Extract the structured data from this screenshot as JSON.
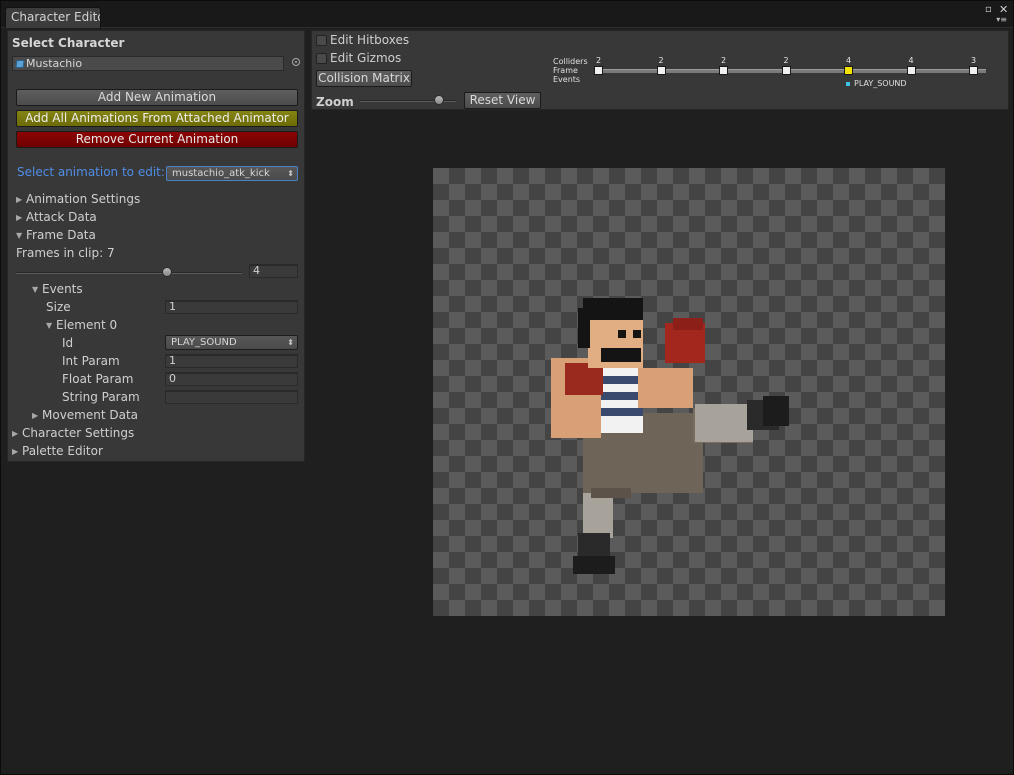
{
  "window": {
    "tab_title": "Character Edito",
    "icons": {
      "maximize": "maximize-icon",
      "close": "close-icon",
      "menu": "panel-menu-icon"
    }
  },
  "inspector": {
    "header": "Select Character",
    "character_field": "Mustachio",
    "buttons": {
      "add_new": "Add New Animation",
      "add_all": "Add All Animations From Attached Animator",
      "remove": "Remove Current Animation"
    },
    "select_label": "Select animation to edit:",
    "selected_animation": "mustachio_atk_kick",
    "sections": {
      "animation_settings": "Animation Settings",
      "attack_data": "Attack Data",
      "frame_data": "Frame Data",
      "movement_data": "Movement Data",
      "character_settings": "Character Settings",
      "palette_editor": "Palette Editor"
    },
    "frames_in_clip": "Frames in clip: 7",
    "frame_value": "4",
    "frame_slider_fraction": 0.667,
    "events": {
      "label": "Events",
      "size_label": "Size",
      "size_value": "1",
      "element_label": "Element 0",
      "id_label": "Id",
      "id_value": "PLAY_SOUND",
      "int_label": "Int Param",
      "int_value": "1",
      "float_label": "Float Param",
      "float_value": "0",
      "string_label": "String Param",
      "string_value": ""
    }
  },
  "toolbar": {
    "edit_hitboxes": "Edit Hitboxes",
    "edit_gizmos": "Edit Gizmos",
    "collision_matrix": "Collision Matrix",
    "zoom": "Zoom",
    "zoom_fraction": 0.82,
    "reset_view": "Reset View"
  },
  "timeline": {
    "labels": {
      "colliders": "Colliders",
      "frame": "Frame",
      "events": "Events"
    },
    "collider_counts": [
      "2",
      "2",
      "2",
      "2",
      "4",
      "4",
      "3"
    ],
    "selected_frame_index": 4,
    "event_name": "PLAY_SOUND",
    "colors": {
      "selected": "#f3e300",
      "event": "#39c2e3"
    }
  }
}
